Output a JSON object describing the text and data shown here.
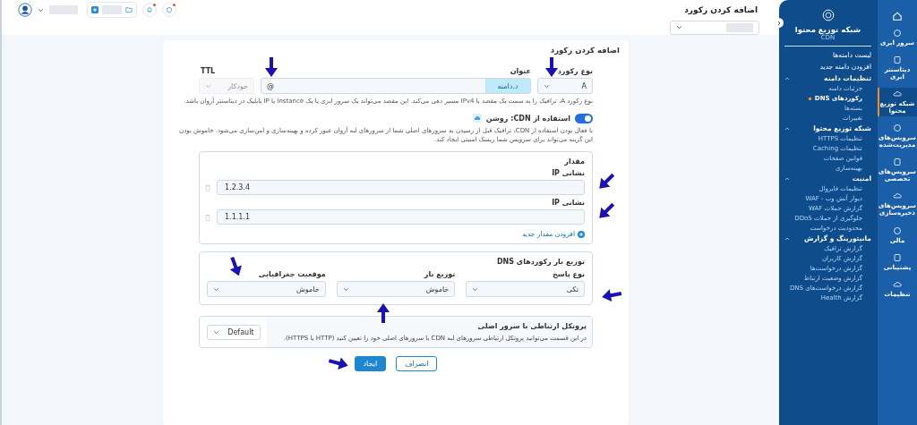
{
  "header": {
    "title": "اضافه کردن رکورد"
  },
  "form": {
    "title": "اضافه کردن رکورد",
    "record_type": {
      "label": "نوع رکورد",
      "value": "A"
    },
    "name": {
      "label": "عنوان",
      "value": "@",
      "suffix": "د.دامنه"
    },
    "ttl": {
      "label": "TTL",
      "placeholder": "خودکار",
      "disabled": true
    },
    "help": "نوع رکورد A، ترافیک را به سمت یک مقصد با IPv4 مسیر دهی می‌کند. این مقصد می‌تواند یک سرور ابری یا یک Instance یا IP پابلیک در دیتاسنتر آروان باشد.",
    "cdn": {
      "label": "استفاده از CDN: روشن",
      "on": true
    },
    "cdn_help": "با فعال بودن استفاده از CDN، ترافیک قبل از رسیدن به سرورهای اصلی شما از سرورهای لبه آروان عبور کرده و بهینه‌سازی و امن‌سازی می‌شود. خاموش بودن این گزینه می‌تواند برای سرویس شما ریسک امنیتی ایجاد کند.",
    "values": {
      "title": "مقدار",
      "entries": [
        {
          "label": "نشانی IP",
          "value": "1.2.3.4"
        },
        {
          "label": "نشانی IP",
          "value": "1.1.1.1"
        }
      ],
      "add_label": "افزودن مقدار جدید"
    },
    "load_balance": {
      "title": "توزیع بار رکوردهای DNS",
      "fields": [
        {
          "label": "نوع پاسخ",
          "value": "تکی"
        },
        {
          "label": "توزیع بار",
          "value": "خاموش"
        },
        {
          "label": "موقعیت جغرافیایی",
          "value": "خاموش"
        }
      ]
    },
    "protocol": {
      "title": "پروتکل ارتباطی با سرور اصلی",
      "description": "در این قسمت می‌توانید پروتکل ارتباطی سرورهای لبه CDN با سرورهای اصلی خود را تعیین کنید (HTTP یا HTTPS).",
      "value": "Default"
    },
    "buttons": [
      {
        "label": "انصراف",
        "kind": "secondary"
      },
      {
        "label": "ایجاد",
        "kind": "primary"
      }
    ]
  },
  "nav_panel": {
    "title": "شبکه توزیع محتوا",
    "subtitle": "CDN",
    "items": [
      {
        "label": "لیست دامنه‌ها",
        "kind": "link",
        "selected": false
      },
      {
        "label": "افزودن دامنه جدید",
        "kind": "link",
        "selected": false
      },
      {
        "label": "تنظیمات دامنه",
        "kind": "group",
        "expanded": true,
        "children": [
          {
            "label": "جزئیات دامنه",
            "selected": false
          },
          {
            "label": "رکوردهای DNS",
            "selected": true
          },
          {
            "label": "بسته‌ها",
            "selected": false
          },
          {
            "label": "تغییرات",
            "selected": false
          }
        ]
      },
      {
        "label": "شبکه توزیع محتوا",
        "kind": "group",
        "expanded": true,
        "children": [
          {
            "label": "تنظیمات HTTPS",
            "selected": false
          },
          {
            "label": "تنظیمات Caching",
            "selected": false
          },
          {
            "label": "قوانین صفحات",
            "selected": false
          },
          {
            "label": "بهینه‌سازی",
            "selected": false
          }
        ]
      },
      {
        "label": "امنیت",
        "kind": "group",
        "expanded": true,
        "children": [
          {
            "label": "تنظیمات فایروال",
            "selected": false
          },
          {
            "label": "دیوار آتش وب - WAF",
            "selected": false
          },
          {
            "label": "گزارش حملات WAF",
            "selected": false
          },
          {
            "label": "جلوگیری از حملات DDoS",
            "selected": false
          },
          {
            "label": "محدودیت درخواست",
            "selected": false
          }
        ]
      },
      {
        "label": "مانیتورینگ و گزارش",
        "kind": "group",
        "expanded": true,
        "children": [
          {
            "label": "گزارش ترافیک",
            "selected": false
          },
          {
            "label": "گزارش کاربران",
            "selected": false
          },
          {
            "label": "گزارش درخواست‌ها",
            "selected": false
          },
          {
            "label": "گزارش وضعیت ارتباط",
            "selected": false
          },
          {
            "label": "گزارش درخواست‌های DNS",
            "selected": false
          },
          {
            "label": "گزارش Health",
            "selected": false
          }
        ]
      }
    ]
  },
  "rail": {
    "items": [
      {
        "label": "سرور ابری",
        "selected": false
      },
      {
        "label": "دیتاسنتر ابری",
        "selected": false
      },
      {
        "label": "شبکه توزیع محتوا",
        "selected": true
      },
      {
        "label": "سرویس‌های مدیریت‌شده",
        "selected": false
      },
      {
        "label": "سرویس‌های تخصصی",
        "selected": false
      },
      {
        "label": "سرویس‌های ذخیره‌سازی",
        "selected": false
      },
      {
        "label": "مالی",
        "selected": false
      },
      {
        "label": "پشتیبانی",
        "selected": false
      },
      {
        "label": "تنظیمات",
        "selected": false
      }
    ]
  }
}
